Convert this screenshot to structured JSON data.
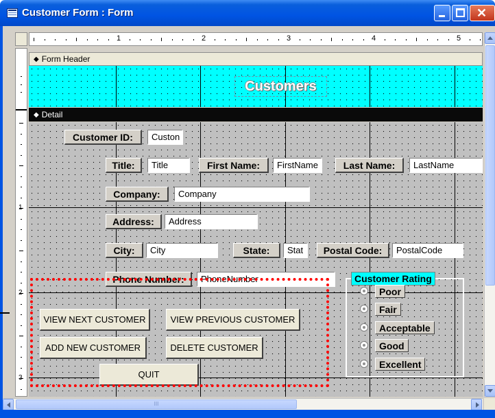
{
  "window": {
    "title": "Customer Form : Form",
    "controls": {
      "minimize": "minimize",
      "maximize": "maximize",
      "close": "close"
    }
  },
  "ruler": {
    "horizontal_numbers": [
      "1",
      "2",
      "3",
      "4",
      "5"
    ],
    "vertical_numbers": [
      "1",
      "2",
      "3"
    ]
  },
  "sections": {
    "form_header": "Form Header",
    "detail": "Detail"
  },
  "header": {
    "title": "Customers"
  },
  "fields": {
    "customer_id": {
      "label": "Customer ID:",
      "value": "Custon"
    },
    "title": {
      "label": "Title:",
      "value": "Title"
    },
    "first_name": {
      "label": "First Name:",
      "value": "FirstName"
    },
    "last_name": {
      "label": "Last Name:",
      "value": "LastName"
    },
    "company": {
      "label": "Company:",
      "value": "Company"
    },
    "address": {
      "label": "Address:",
      "value": "Address"
    },
    "city": {
      "label": "City:",
      "value": "City"
    },
    "state": {
      "label": "State:",
      "value": "Stat"
    },
    "postal_code": {
      "label": "Postal Code:",
      "value": "PostalCode"
    },
    "phone_number": {
      "label": "Phone Number:",
      "value": "PhoneNumber"
    }
  },
  "buttons": {
    "view_next": "VIEW NEXT CUSTOMER",
    "view_previous": "VIEW PREVIOUS CUSTOMER",
    "add_new": "ADD NEW CUSTOMER",
    "delete": "DELETE CUSTOMER",
    "quit": "QUIT"
  },
  "rating": {
    "label": "Customer Rating",
    "options": [
      "Poor",
      "Fair",
      "Acceptable",
      "Good",
      "Excellent"
    ]
  },
  "colors": {
    "header_background": "#00ffff",
    "selection_outline": "#ff0000",
    "titlebar": "#0054e3",
    "detail_grid": "#c0c0c0"
  },
  "scrollbar": {
    "thumb_grip": "III"
  }
}
